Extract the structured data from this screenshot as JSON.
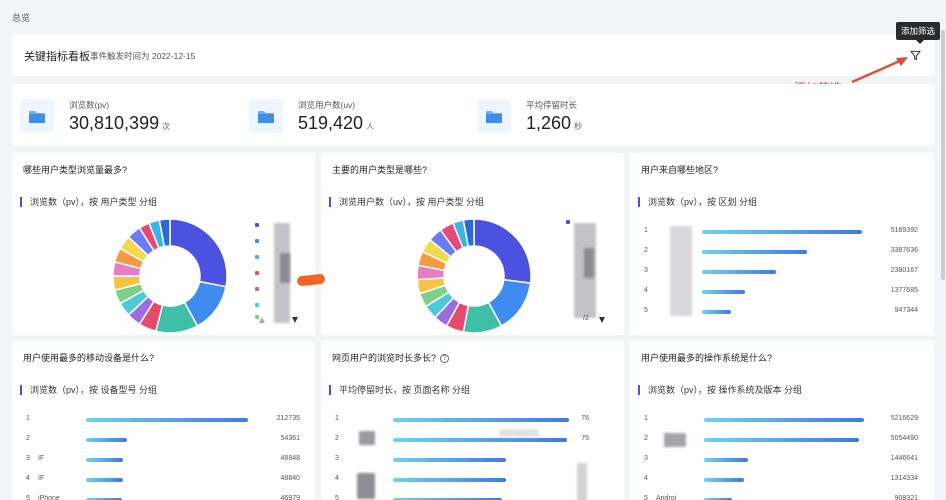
{
  "breadcrumb": "总览",
  "header": {
    "title": "关键指标看板",
    "subtitle": "事件触发时间为 2022-12-15"
  },
  "tooltip": "添加筛选",
  "annotation": "添加筛选",
  "colors": {
    "accent": "#4a53d6",
    "annotation": "#e34a3a",
    "bar_start": "#6ed3f0",
    "bar_end": "#3e7ae0"
  },
  "kpis": [
    {
      "label": "浏览数(pv)",
      "value": "30,810,399",
      "unit": "次",
      "icon": "folder-icon"
    },
    {
      "label": "浏览用户数(uv)",
      "value": "519,420",
      "unit": "人",
      "icon": "folder-icon"
    },
    {
      "label": "平均停留时长",
      "value": "1,260",
      "unit": "秒",
      "icon": "folder-icon"
    }
  ],
  "panels": {
    "user_type": {
      "title": "哪些用户类型浏览量最多?",
      "subtitle": "浏览数（pv），按 用户类型 分组"
    },
    "main_user_type": {
      "title": "主要的用户类型是哪些?",
      "subtitle": "浏览用户数（uv），按 用户类型 分组",
      "pager": "/2"
    },
    "region": {
      "title": "用户来自哪些地区?",
      "subtitle": "浏览数（pv），按 区划 分组",
      "rows": [
        {
          "idx": "1",
          "label": "",
          "value": 5169392,
          "value_text": "5169392"
        },
        {
          "idx": "2",
          "label": "",
          "value": 3387636,
          "value_text": "3387636"
        },
        {
          "idx": "3",
          "label": "",
          "value": 2380167,
          "value_text": "2380167"
        },
        {
          "idx": "4",
          "label": "",
          "value": 1377685,
          "value_text": "1377685"
        },
        {
          "idx": "5",
          "label": "",
          "value": 947344,
          "value_text": "947344"
        }
      ]
    },
    "device": {
      "title": "用户使用最多的移动设备是什么?",
      "subtitle": "浏览数（pv），按 设备型号 分组",
      "rows": [
        {
          "idx": "1",
          "label": "",
          "value": 212735,
          "value_text": "212735"
        },
        {
          "idx": "2",
          "label": "",
          "value": 54361,
          "value_text": "54361"
        },
        {
          "idx": "3",
          "label": "IF",
          "value": 48848,
          "value_text": "48848"
        },
        {
          "idx": "4",
          "label": "IF",
          "value": 48840,
          "value_text": "48840"
        },
        {
          "idx": "5",
          "label": "iPhone",
          "value": 46979,
          "value_text": "46979"
        }
      ]
    },
    "dwell": {
      "title": "网页用户的浏览时长多长?",
      "subtitle": "平均停留时长，按 页面名称 分组",
      "rows": [
        {
          "idx": "1",
          "label": "",
          "value": 76,
          "value_text": "76"
        },
        {
          "idx": "2",
          "label": "",
          "value": 75,
          "value_text": "75"
        },
        {
          "idx": "3",
          "label": "",
          "value": 49,
          "value_text": ""
        },
        {
          "idx": "4",
          "label": "",
          "value": 49,
          "value_text": ""
        },
        {
          "idx": "5",
          "label": "",
          "value": 47,
          "value_text": ""
        }
      ]
    },
    "os": {
      "title": "用户使用最多的操作系统是什么?",
      "subtitle": "浏览数（pv），按 操作系统及版本 分组",
      "rows": [
        {
          "idx": "1",
          "label": "",
          "value": 5216629,
          "value_text": "5216629"
        },
        {
          "idx": "2",
          "label": "",
          "value": 5054490,
          "value_text": "5054490"
        },
        {
          "idx": "3",
          "label": "",
          "value": 1446641,
          "value_text": "1446641"
        },
        {
          "idx": "4",
          "label": "",
          "value": 1314334,
          "value_text": "1314334"
        },
        {
          "idx": "5",
          "label": "Androi",
          "value": 908321,
          "value_text": "908321"
        }
      ]
    }
  },
  "donut1": [
    {
      "value": 28,
      "color": "#4c52e0"
    },
    {
      "value": 14,
      "color": "#3f8cf0"
    },
    {
      "value": 12,
      "color": "#3fbfa7"
    },
    {
      "value": 5,
      "color": "#e64b6e"
    },
    {
      "value": 4,
      "color": "#9b6de0"
    },
    {
      "value": 4,
      "color": "#4fc9d9"
    },
    {
      "value": 4,
      "color": "#7dd18a"
    },
    {
      "value": 4,
      "color": "#f5c542"
    },
    {
      "value": 4,
      "color": "#e67ec3"
    },
    {
      "value": 4,
      "color": "#f59a42"
    },
    {
      "value": 4,
      "color": "#f2d94e"
    },
    {
      "value": 4,
      "color": "#6a7df0"
    },
    {
      "value": 3,
      "color": "#e54b7a"
    },
    {
      "value": 3,
      "color": "#3cb4e6"
    },
    {
      "value": 3,
      "color": "#2a6ad8"
    }
  ],
  "donut2": [
    {
      "value": 27,
      "color": "#4c52e0"
    },
    {
      "value": 15,
      "color": "#3f8cf0"
    },
    {
      "value": 11,
      "color": "#3fbfa7"
    },
    {
      "value": 5,
      "color": "#e64b6e"
    },
    {
      "value": 4,
      "color": "#9b6de0"
    },
    {
      "value": 4,
      "color": "#4fc9d9"
    },
    {
      "value": 4,
      "color": "#7dd18a"
    },
    {
      "value": 4,
      "color": "#f5c542"
    },
    {
      "value": 4,
      "color": "#e67ec3"
    },
    {
      "value": 4,
      "color": "#f59a42"
    },
    {
      "value": 4,
      "color": "#f2d94e"
    },
    {
      "value": 4,
      "color": "#6a7df0"
    },
    {
      "value": 4,
      "color": "#e54b7a"
    },
    {
      "value": 3,
      "color": "#3cb4e6"
    },
    {
      "value": 3,
      "color": "#2a6ad8"
    }
  ]
}
